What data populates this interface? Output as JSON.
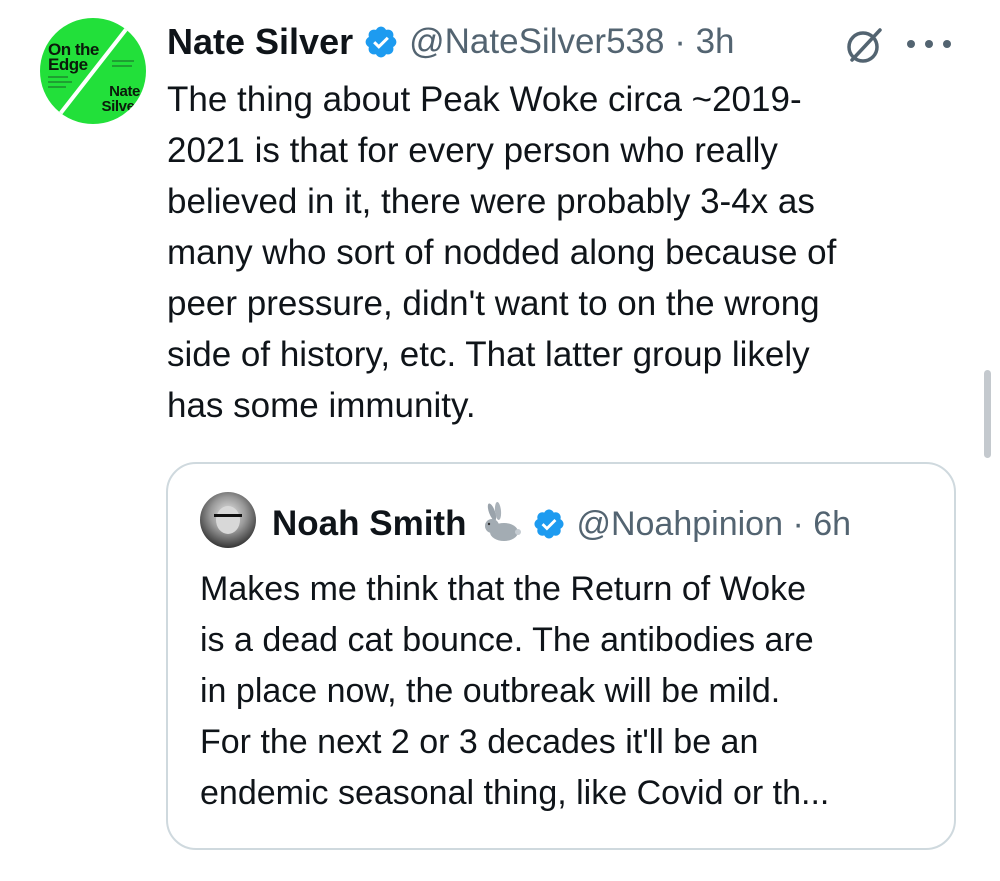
{
  "tweet": {
    "author_name": "Nate Silver",
    "author_handle": "@NateSilver538 · 3h",
    "avatar": {
      "book_title": "On the\nEdge",
      "book_author": "Nate\nSilver",
      "background_color": "#22e03a"
    },
    "verified_icon": "verified-badge-icon",
    "grok_icon": "grok-icon",
    "more_icon": "more-options-icon",
    "text": "The thing about Peak Woke circa ~2019-\n2021 is that for every person who really\nbelieved in it, there were probably 3-4x as\nmany who sort of nodded along because of\npeer pressure, didn't want to on the wrong\nside of history, etc. That latter group likely\nhas some immunity."
  },
  "quoted_tweet": {
    "author_name": "Noah Smith",
    "emoji_icon": "rabbit-icon",
    "author_handle": "@Noahpinion · 6h",
    "text": "Makes me think that the Return of Woke\nis a dead cat bounce. The antibodies are\nin place now, the outbreak will be mild.\nFor the next 2 or 3 decades it'll be an\nendemic seasonal thing, like Covid or th..."
  },
  "colors": {
    "verified_blue": "#1d9bf0",
    "secondary_text": "#536471",
    "border": "#cfd9de"
  }
}
